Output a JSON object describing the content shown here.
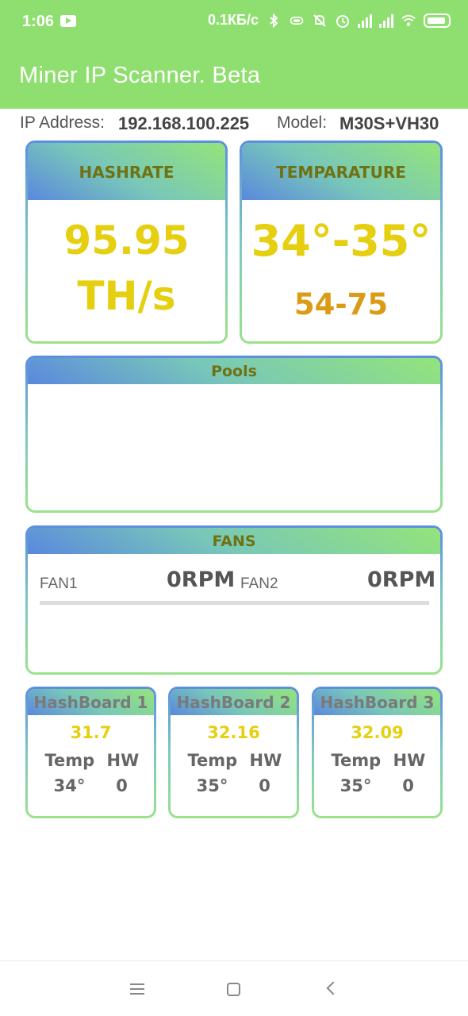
{
  "status_bar": {
    "time": "1:06",
    "network_speed": "0.1КБ/с",
    "icons": [
      "youtube-icon",
      "bluetooth-icon",
      "vibrate-icon",
      "mute-icon",
      "alarm-icon",
      "signal-icon",
      "signal-icon",
      "wifi-icon",
      "battery-icon"
    ]
  },
  "app_bar": {
    "title": "Miner IP Scanner. Beta",
    "color": "#8fdf70"
  },
  "info": {
    "ip_label": "IP Address:",
    "ip_value": "192.168.100.225",
    "model_label": "Model:",
    "model_value": "M30S+VH30"
  },
  "hashrate": {
    "title": "HASHRATE",
    "value": "95.95",
    "unit": "TH/s"
  },
  "temperature": {
    "title": "TEMPARATURE",
    "value": "34°-35°",
    "range": "54-75"
  },
  "pools": {
    "title": "Pools"
  },
  "fans": {
    "title": "FANS",
    "fan1_label": "FAN1",
    "fan1_value": "0RPM",
    "fan2_label": "FAN2",
    "fan2_value": "0RPM"
  },
  "hashboards": [
    {
      "title": "HashBoard 1",
      "rate": "31.7",
      "temp_label": "Temp",
      "hw_label": "HW",
      "temp": "34°",
      "hw": "0"
    },
    {
      "title": "HashBoard 2",
      "rate": "32.16",
      "temp_label": "Temp",
      "hw_label": "HW",
      "temp": "35°",
      "hw": "0"
    },
    {
      "title": "HashBoard 3",
      "rate": "32.09",
      "temp_label": "Temp",
      "hw_label": "HW",
      "temp": "35°",
      "hw": "0"
    }
  ],
  "colors": {
    "accent_green": "#8fdf70",
    "value_yellow": "#e5cf10",
    "range_orange": "#db9b14",
    "header_blue": "#5a88de"
  }
}
